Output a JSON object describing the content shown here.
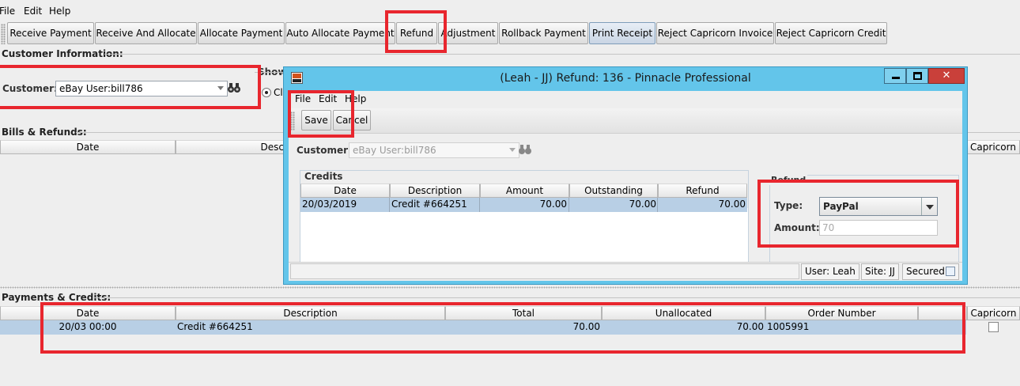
{
  "menu": {
    "file": "File",
    "edit": "Edit",
    "help": "Help"
  },
  "toolbar": [
    "Receive Payment",
    "Receive And Allocate",
    "Allocate Payment",
    "Auto Allocate Payment",
    "Refund",
    "Adjustment",
    "Rollback Payment",
    "Print Receipt",
    "Reject Capricorn Invoice",
    "Reject Capricorn Credit"
  ],
  "customer_info": {
    "section": "Customer Information:",
    "label": "Customer:",
    "value": "eBay User:bill786",
    "show_label": "Show",
    "radio_partial": "Cl"
  },
  "bills": {
    "section": "Bills & Refunds:",
    "headers": [
      "Date",
      "Desc",
      "Capricorn"
    ]
  },
  "payments": {
    "section": "Payments & Credits:",
    "headers": [
      "Date",
      "Description",
      "Total",
      "Unallocated",
      "Order Number",
      "",
      "Capricorn"
    ],
    "rows": [
      {
        "date": "20/03 00:00",
        "description": "Credit #664251",
        "total": "70.00",
        "unallocated": "70.00",
        "order": "1005991",
        "capricorn": false
      }
    ]
  },
  "dialog": {
    "title": "(Leah - JJ) Refund: 136 - Pinnacle Professional",
    "menu": {
      "file": "File",
      "edit": "Edit",
      "help": "Help"
    },
    "save": "Save",
    "cancel": "Cancel",
    "customer_label": "Customer",
    "customer_value": "eBay User:bill786",
    "credits_title": "Credits",
    "credit_headers": [
      "Date",
      "Description",
      "Amount",
      "Outstanding",
      "Refund"
    ],
    "credit_rows": [
      {
        "date": "20/03/2019",
        "description": "Credit #664251",
        "amount": "70.00",
        "outstanding": "70.00",
        "refund": "70.00"
      }
    ],
    "refund_title": "Refund",
    "type_label": "Type:",
    "type_value": "PayPal",
    "amount_label": "Amount:",
    "amount_value": "70",
    "status": {
      "user": "User: Leah",
      "site": "Site: JJ",
      "secured": "Secured"
    }
  },
  "colors": {
    "highlight": "#e8262e",
    "dialog_frame": "#63c5ea",
    "selection": "#b8cfe5"
  }
}
